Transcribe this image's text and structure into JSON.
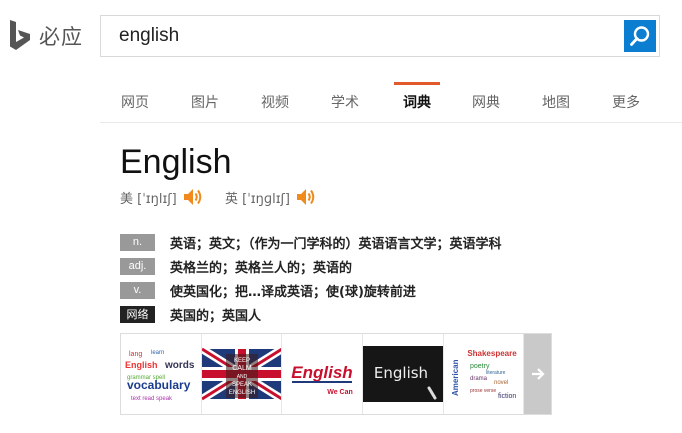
{
  "header": {
    "logo_text": "必应",
    "search": {
      "value": "english"
    }
  },
  "nav": {
    "tabs": [
      {
        "label": "网页"
      },
      {
        "label": "图片"
      },
      {
        "label": "视频"
      },
      {
        "label": "学术"
      },
      {
        "label": "词典",
        "active": true
      },
      {
        "label": "网典"
      },
      {
        "label": "地图"
      },
      {
        "label": "更多"
      }
    ]
  },
  "entry": {
    "headword": "English",
    "pron_us": "美 [ˈɪŋlɪʃ]",
    "pron_uk": "英 [ˈɪŋɡlɪʃ]",
    "definitions": [
      {
        "pos": "n.",
        "text": "英语；英文；（作为一门学科的）英语语言文学；英语学科"
      },
      {
        "pos": "adj.",
        "text": "英格兰的；英格兰人的；英语的"
      },
      {
        "pos": "v.",
        "text": "使英国化；把…译成英语；使(球)旋转前进"
      },
      {
        "pos": "网络",
        "text": "英国的；英国人"
      }
    ]
  },
  "images": {
    "thumb1_words": [
      "words",
      "vocabulary"
    ],
    "thumb2_words": [
      "KEEP",
      "CALM",
      "AND",
      "SPEAK",
      "ENGLISH"
    ],
    "thumb3_words": [
      "English",
      "We Can"
    ],
    "thumb4_words": [
      "English"
    ],
    "thumb5_words": [
      "Shakespeare",
      "American",
      "poetry",
      "fiction"
    ]
  },
  "colors": {
    "accent": "#e25a2c",
    "search_button": "#0c7ed1"
  }
}
